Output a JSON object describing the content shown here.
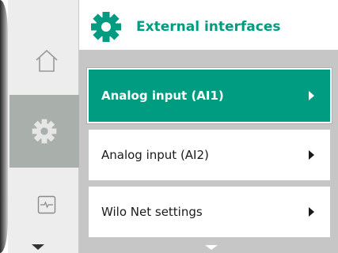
{
  "header": {
    "title": "External interfaces",
    "icon": "gear-icon",
    "accent_color": "#009c82"
  },
  "sidebar": {
    "items": [
      {
        "name": "home",
        "icon": "home-icon",
        "selected": false
      },
      {
        "name": "settings",
        "icon": "gear-icon",
        "selected": true
      },
      {
        "name": "monitor",
        "icon": "pulse-monitor-icon",
        "selected": false
      }
    ]
  },
  "menu": {
    "items": [
      {
        "label": "Analog input (AI1)",
        "selected": true
      },
      {
        "label": "Analog input (AI2)",
        "selected": false
      },
      {
        "label": "Wilo Net settings",
        "selected": false
      }
    ]
  }
}
